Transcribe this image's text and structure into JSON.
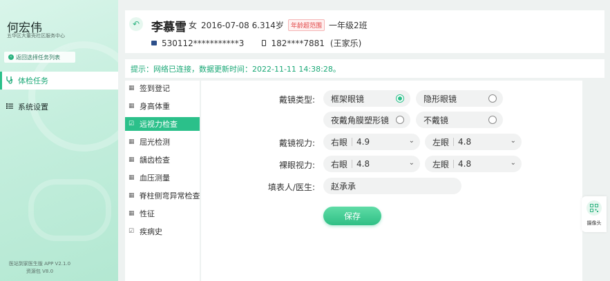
{
  "sidebar": {
    "user_name": "何宏伟",
    "org_name": "五华区大董壳社区服务中心",
    "back_label": "返回选择任务列表",
    "nav": [
      {
        "label": "体检任务",
        "icon": "stethoscope-icon"
      },
      {
        "label": "系统设置",
        "icon": "settings-list-icon"
      }
    ],
    "version_line1": "医站到家医生版 APP V2.1.0",
    "version_line2": "资源包 V8.0"
  },
  "header": {
    "name": "李慕雪",
    "gender": "女",
    "birth_age": "2016-07-08 6.314岁",
    "age_badge": "年龄超范围",
    "class": "一年级2班",
    "id_number": "530112***********3",
    "phone": "182****7881",
    "guardian": "(王家乐)"
  },
  "tip": "提示：网络已连接，数据更新时间：2022-11-11  14:38:28。",
  "subnav": [
    {
      "label": "签到登记",
      "icon": "grid-icon",
      "active": false
    },
    {
      "label": "身高体重",
      "icon": "grid-icon",
      "active": false
    },
    {
      "label": "远视力检查",
      "icon": "check-icon",
      "active": true
    },
    {
      "label": "屈光检测",
      "icon": "grid-icon",
      "active": false
    },
    {
      "label": "龋齿检查",
      "icon": "grid-icon",
      "active": false
    },
    {
      "label": "血压测量",
      "icon": "grid-icon",
      "active": false
    },
    {
      "label": "脊柱侧弯异常检查",
      "icon": "grid-icon",
      "active": false
    },
    {
      "label": "性征",
      "icon": "grid-icon",
      "active": false
    },
    {
      "label": "疾病史",
      "icon": "check-icon",
      "active": false
    }
  ],
  "form": {
    "glasses_type_label": "戴镜类型:",
    "glasses_options": [
      {
        "label": "框架眼镜",
        "checked": true
      },
      {
        "label": "隐形眼镜",
        "checked": false
      },
      {
        "label": "夜戴角膜塑形镜",
        "checked": false
      },
      {
        "label": "不戴镜",
        "checked": false
      }
    ],
    "corrected_label": "戴镜视力:",
    "corrected_right_label": "右眼",
    "corrected_right_value": "4.9",
    "corrected_left_label": "左眼",
    "corrected_left_value": "4.8",
    "naked_label": "裸眼视力:",
    "naked_right_label": "右眼",
    "naked_right_value": "4.8",
    "naked_left_label": "左眼",
    "naked_left_value": "4.8",
    "filler_label": "填表人/医生:",
    "filler_value": "赵承承",
    "save_label": "保存"
  },
  "camera_label": "摄像头",
  "colors": {
    "accent": "#2bc08a",
    "badge_red": "#e04545"
  }
}
